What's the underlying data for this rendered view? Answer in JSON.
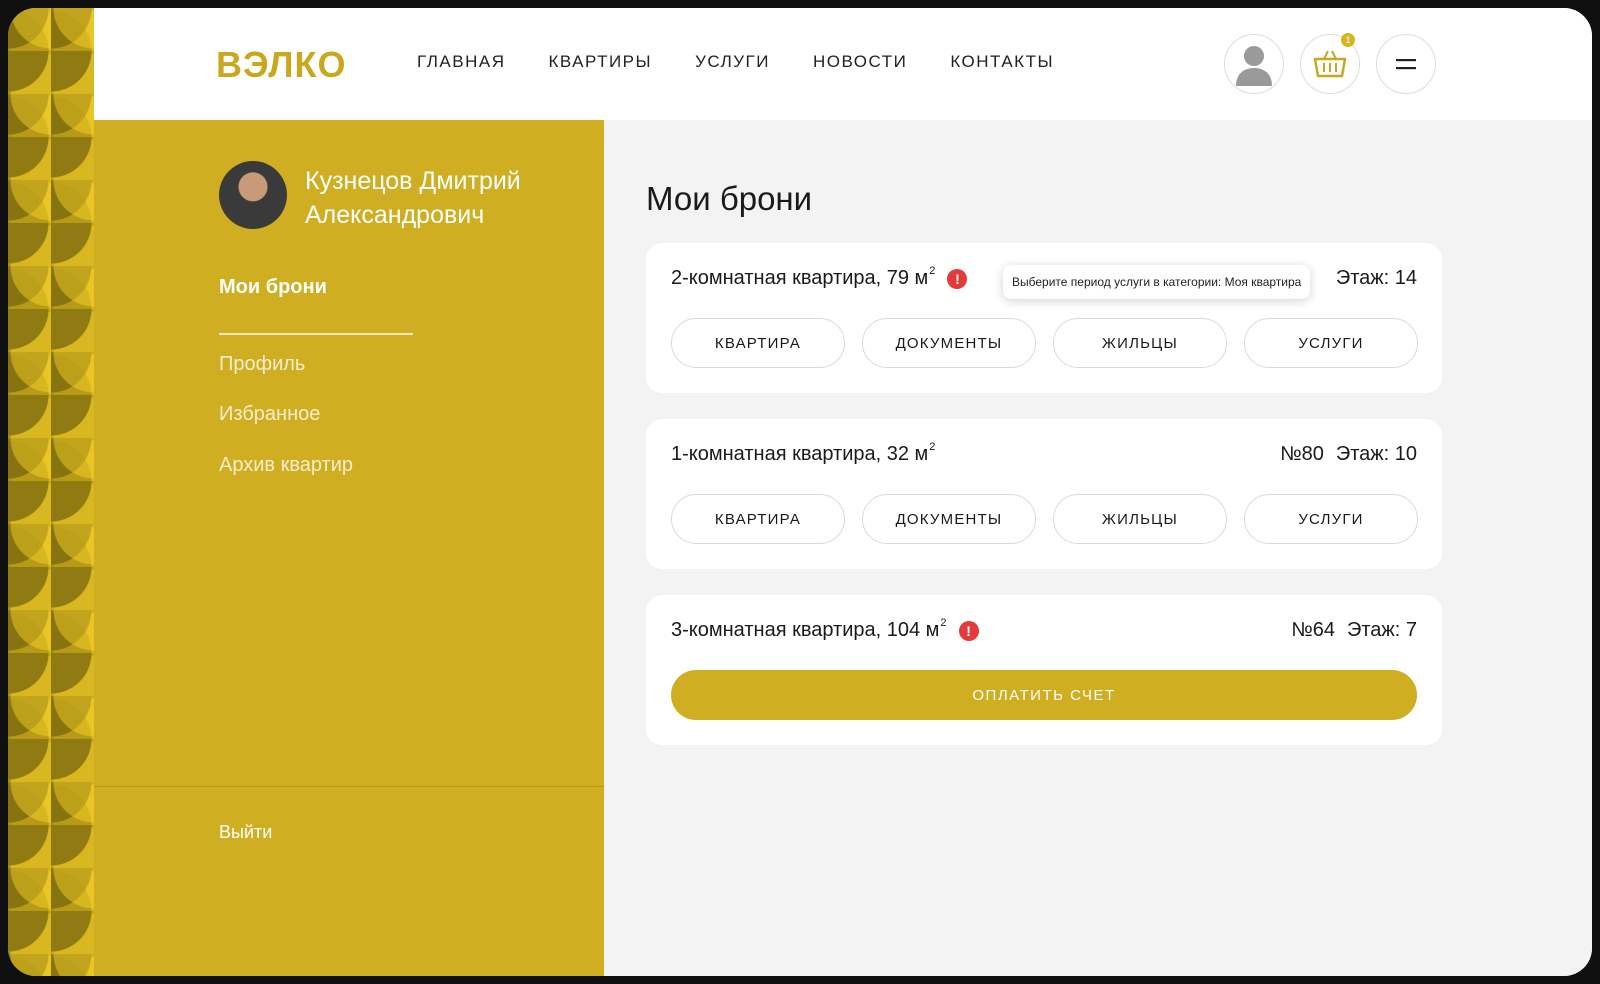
{
  "header": {
    "logo": "ВЭЛКО",
    "nav": [
      "ГЛАВНАЯ",
      "КВАРТИРЫ",
      "УСЛУГИ",
      "НОВОСТИ",
      "КОНТАКТЫ"
    ],
    "cart_count": "1"
  },
  "sidebar": {
    "user_name": "Кузнецов Дмитрий Александрович",
    "items": [
      "Мои брони",
      "Профиль",
      "Избранное",
      "Архив квартир"
    ],
    "logout": "Выйти"
  },
  "main": {
    "title": "Мои брони",
    "tooltip": "Выберите период услуги в категории: Моя квартира",
    "tabs": [
      "КВАРТИРА",
      "ДОКУМЕНТЫ",
      "ЖИЛЬЦЫ",
      "УСЛУГИ"
    ],
    "bookings": [
      {
        "title": "2-комнатная квартира, 79 м",
        "sup": "2",
        "number": "",
        "floor": "Этаж: 14"
      },
      {
        "title": "1-комнатная квартира, 32 м",
        "sup": "2",
        "number": "№80",
        "floor": "Этаж: 10"
      },
      {
        "title": "3-комнатная квартира, 104 м",
        "sup": "2",
        "number": "№64",
        "floor": "Этаж: 7"
      }
    ],
    "pay_button": "ОПЛАТИТЬ СЧЕТ"
  },
  "colors": {
    "accent": "#cfae22",
    "alert": "#e33b3b"
  }
}
